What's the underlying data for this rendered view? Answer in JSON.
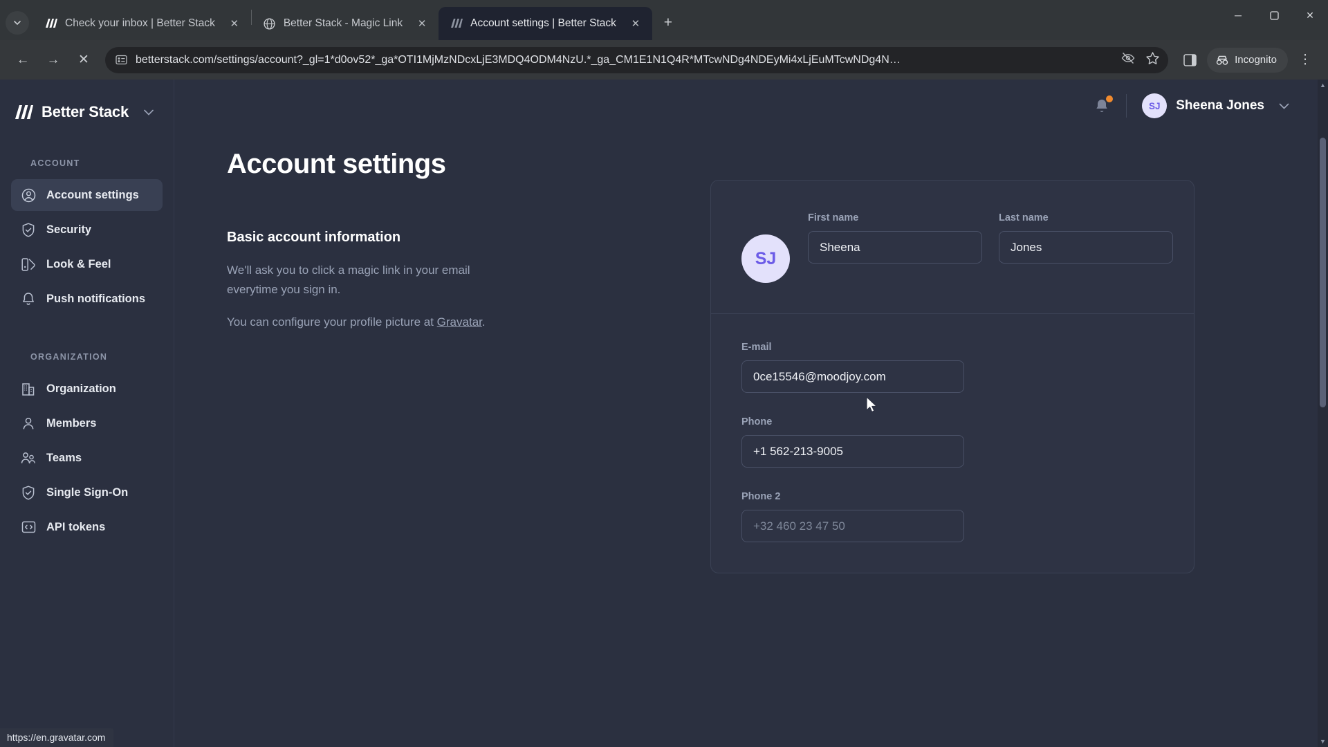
{
  "browser": {
    "tabs": [
      {
        "title": "Check your inbox | Better Stack",
        "favicon": "betterstack-logo-icon",
        "active": false
      },
      {
        "title": "Better Stack - Magic Link",
        "favicon": "globe-icon",
        "active": false
      },
      {
        "title": "Account settings | Better Stack",
        "favicon": "betterstack-logo-icon",
        "active": true
      }
    ],
    "new_tab_label": "+",
    "tab_close_label": "✕",
    "window_controls": {
      "minimize": "─",
      "maximize": "❐",
      "close": "✕"
    },
    "nav": {
      "back": "←",
      "forward": "→",
      "stop": "✕"
    },
    "url": "betterstack.com/settings/account?_gl=1*d0ov52*_ga*OTI1MjMzNDcxLjE3MDQ4ODM4NzU.*_ga_CM1E1N1Q4R*MTcwNDg4NDEyMi4xLjEuMTcwNDg4N…",
    "profile_label": "Incognito",
    "menu_label": "⋮"
  },
  "sidebar": {
    "brand": "Better Stack",
    "sections": [
      {
        "label": "ACCOUNT",
        "items": [
          {
            "label": "Account settings",
            "icon": "user-circle-icon",
            "active": true
          },
          {
            "label": "Security",
            "icon": "shield-check-icon",
            "active": false
          },
          {
            "label": "Look & Feel",
            "icon": "palette-icon",
            "active": false
          },
          {
            "label": "Push notifications",
            "icon": "bell-icon",
            "active": false
          }
        ]
      },
      {
        "label": "ORGANIZATION",
        "items": [
          {
            "label": "Organization",
            "icon": "building-icon",
            "active": false
          },
          {
            "label": "Members",
            "icon": "user-icon",
            "active": false
          },
          {
            "label": "Teams",
            "icon": "users-icon",
            "active": false
          },
          {
            "label": "Single Sign-On",
            "icon": "shield-check-icon",
            "active": false
          },
          {
            "label": "API tokens",
            "icon": "code-brackets-icon",
            "active": false
          }
        ]
      }
    ],
    "status_url": "https://en.gravatar.com"
  },
  "topbar": {
    "notifications_icon": "bell-icon",
    "has_unread": true,
    "user": {
      "initials": "SJ",
      "name": "Sheena Jones"
    }
  },
  "page": {
    "title": "Account settings",
    "description": {
      "heading": "Basic account information",
      "paragraph1": "We'll ask you to click a magic link in your email everytime you sign in.",
      "paragraph2_prefix": "You can configure your profile picture at ",
      "paragraph2_link": "Gravatar",
      "paragraph2_suffix": "."
    },
    "form": {
      "avatar_initials": "SJ",
      "first_name": {
        "label": "First name",
        "value": "Sheena"
      },
      "last_name": {
        "label": "Last name",
        "value": "Jones"
      },
      "email": {
        "label": "E-mail",
        "value": "0ce15546@moodjoy.com"
      },
      "phone": {
        "label": "Phone",
        "value": "+1 562-213-9005"
      },
      "phone2": {
        "label": "Phone 2",
        "value": "",
        "placeholder": "+32 460 23 47 50"
      }
    }
  },
  "colors": {
    "accent": "#6c5ce7",
    "sidebar_bg": "#2b3040",
    "card_bg": "#2e3344",
    "notification_dot": "#f08a2e"
  }
}
